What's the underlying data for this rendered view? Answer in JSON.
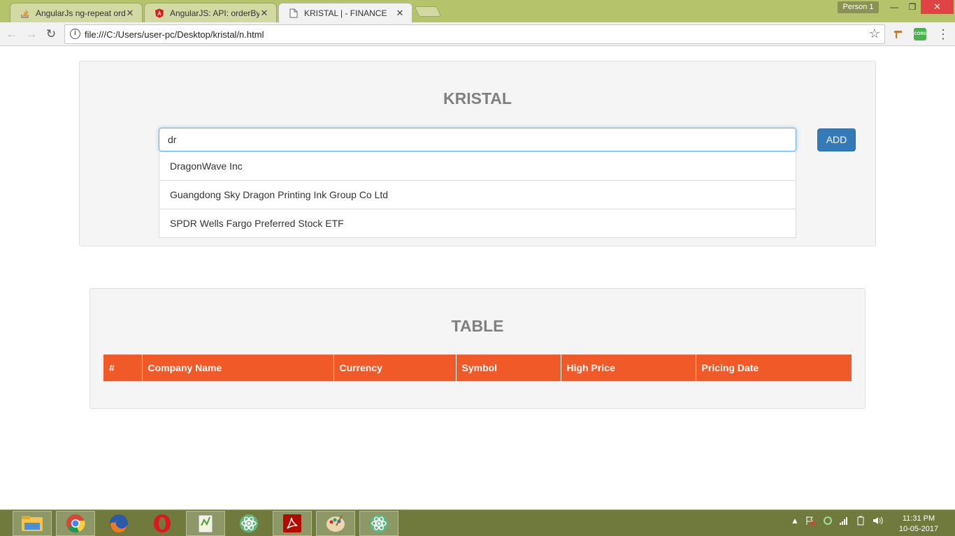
{
  "browser": {
    "tabs": [
      {
        "title": "AngularJs ng-repeat orde",
        "active": false,
        "favicon": "stackoverflow-icon"
      },
      {
        "title": "AngularJS: API: orderBy",
        "active": false,
        "favicon": "angular-icon"
      },
      {
        "title": "KRISTAL | - FINANCE",
        "active": true,
        "favicon": "page-icon"
      }
    ],
    "profile": "Person 1",
    "url": "file:///C:/Users/user-pc/Desktop/kristal/n.html",
    "extension_label": "CORS"
  },
  "page": {
    "header_title": "KRISTAL",
    "search": {
      "value": "dr",
      "placeholder": ""
    },
    "add_label": "ADD",
    "suggestions": [
      "DragonWave Inc",
      "Guangdong Sky Dragon Printing Ink Group Co Ltd",
      "SPDR Wells Fargo Preferred Stock ETF"
    ],
    "table_title": "TABLE",
    "table_headers": [
      "#",
      "Company Name",
      "Currency",
      "Symbol",
      "High Price",
      "Pricing Date"
    ]
  },
  "taskbar": {
    "apps": [
      "file-explorer-icon",
      "chrome-icon",
      "firefox-icon",
      "opera-icon",
      "notepadpp-icon",
      "atom-icon",
      "acrobat-icon",
      "paint-icon",
      "atom-icon"
    ],
    "time": "11:31 PM",
    "date": "10-05-2017"
  },
  "colors": {
    "accent": "#f05a28",
    "button": "#337ab7",
    "titlebar": "#b5c36b",
    "taskbar": "#6f7a3c"
  }
}
